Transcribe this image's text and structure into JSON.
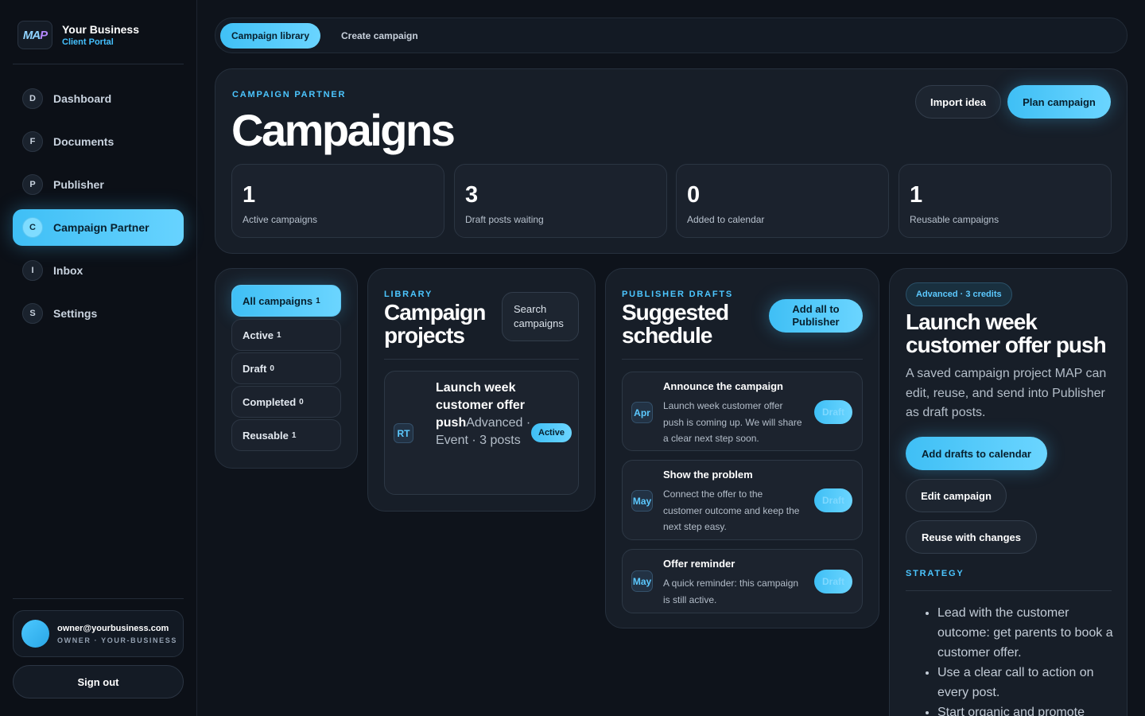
{
  "brand": {
    "logo_a": "MA",
    "logo_b": "P",
    "name": "Your Business",
    "subtitle": "Client Portal"
  },
  "nav": [
    {
      "badge": "D",
      "label": "Dashboard"
    },
    {
      "badge": "F",
      "label": "Documents"
    },
    {
      "badge": "P",
      "label": "Publisher"
    },
    {
      "badge": "C",
      "label": "Campaign Partner",
      "active": true
    },
    {
      "badge": "I",
      "label": "Inbox"
    },
    {
      "badge": "S",
      "label": "Settings"
    }
  ],
  "user": {
    "email": "owner@yourbusiness.com",
    "role": "OWNER · YOUR-BUSINESS",
    "signout_label": "Sign out"
  },
  "tabs": {
    "library": "Campaign library",
    "create": "Create campaign"
  },
  "hero": {
    "eyebrow": "CAMPAIGN PARTNER",
    "title": "Campaigns",
    "import_label": "Import idea",
    "plan_label": "Plan campaign",
    "stats": [
      {
        "value": "1",
        "label": "Active campaigns"
      },
      {
        "value": "3",
        "label": "Draft posts waiting"
      },
      {
        "value": "0",
        "label": "Added to calendar"
      },
      {
        "value": "1",
        "label": "Reusable campaigns"
      }
    ]
  },
  "filters": [
    {
      "label": "All campaigns",
      "count": "1",
      "active": true
    },
    {
      "label": "Active",
      "count": "1"
    },
    {
      "label": "Draft",
      "count": "0"
    },
    {
      "label": "Completed",
      "count": "0"
    },
    {
      "label": "Reusable",
      "count": "1"
    }
  ],
  "library": {
    "eyebrow": "LIBRARY",
    "title": "Campaign projects",
    "search_label": "Search campaigns",
    "project": {
      "initials": "RT",
      "title": "Launch week customer offer push",
      "meta": "Advanced · Event · 3 posts",
      "status": "Active"
    }
  },
  "schedule": {
    "eyebrow": "PUBLISHER DRAFTS",
    "title": "Suggested schedule",
    "add_all_label": "Add all to Publisher",
    "posts": [
      {
        "month": "Apr",
        "title": "Announce the campaign",
        "body": "Launch week customer offer push is coming up. We will share a clear next step soon.",
        "status": "Draft"
      },
      {
        "month": "May",
        "title": "Show the problem",
        "body": "Connect the offer to the customer outcome and keep the next step easy.",
        "status": "Draft"
      },
      {
        "month": "May",
        "title": "Offer reminder",
        "body": "A quick reminder: this campaign is still active.",
        "status": "Draft"
      }
    ]
  },
  "detail": {
    "badge": "Advanced · 3 credits",
    "title": "Launch week customer offer push",
    "description": "A saved campaign project MAP can edit, reuse, and send into Publisher as draft posts.",
    "add_drafts_label": "Add drafts to calendar",
    "edit_label": "Edit campaign",
    "reuse_label": "Reuse with changes",
    "strategy_eyebrow": "STRATEGY",
    "strategy": [
      "Lead with the customer outcome: get parents to book a customer offer.",
      "Use a clear call to action on every post.",
      "Start organic and promote"
    ]
  }
}
